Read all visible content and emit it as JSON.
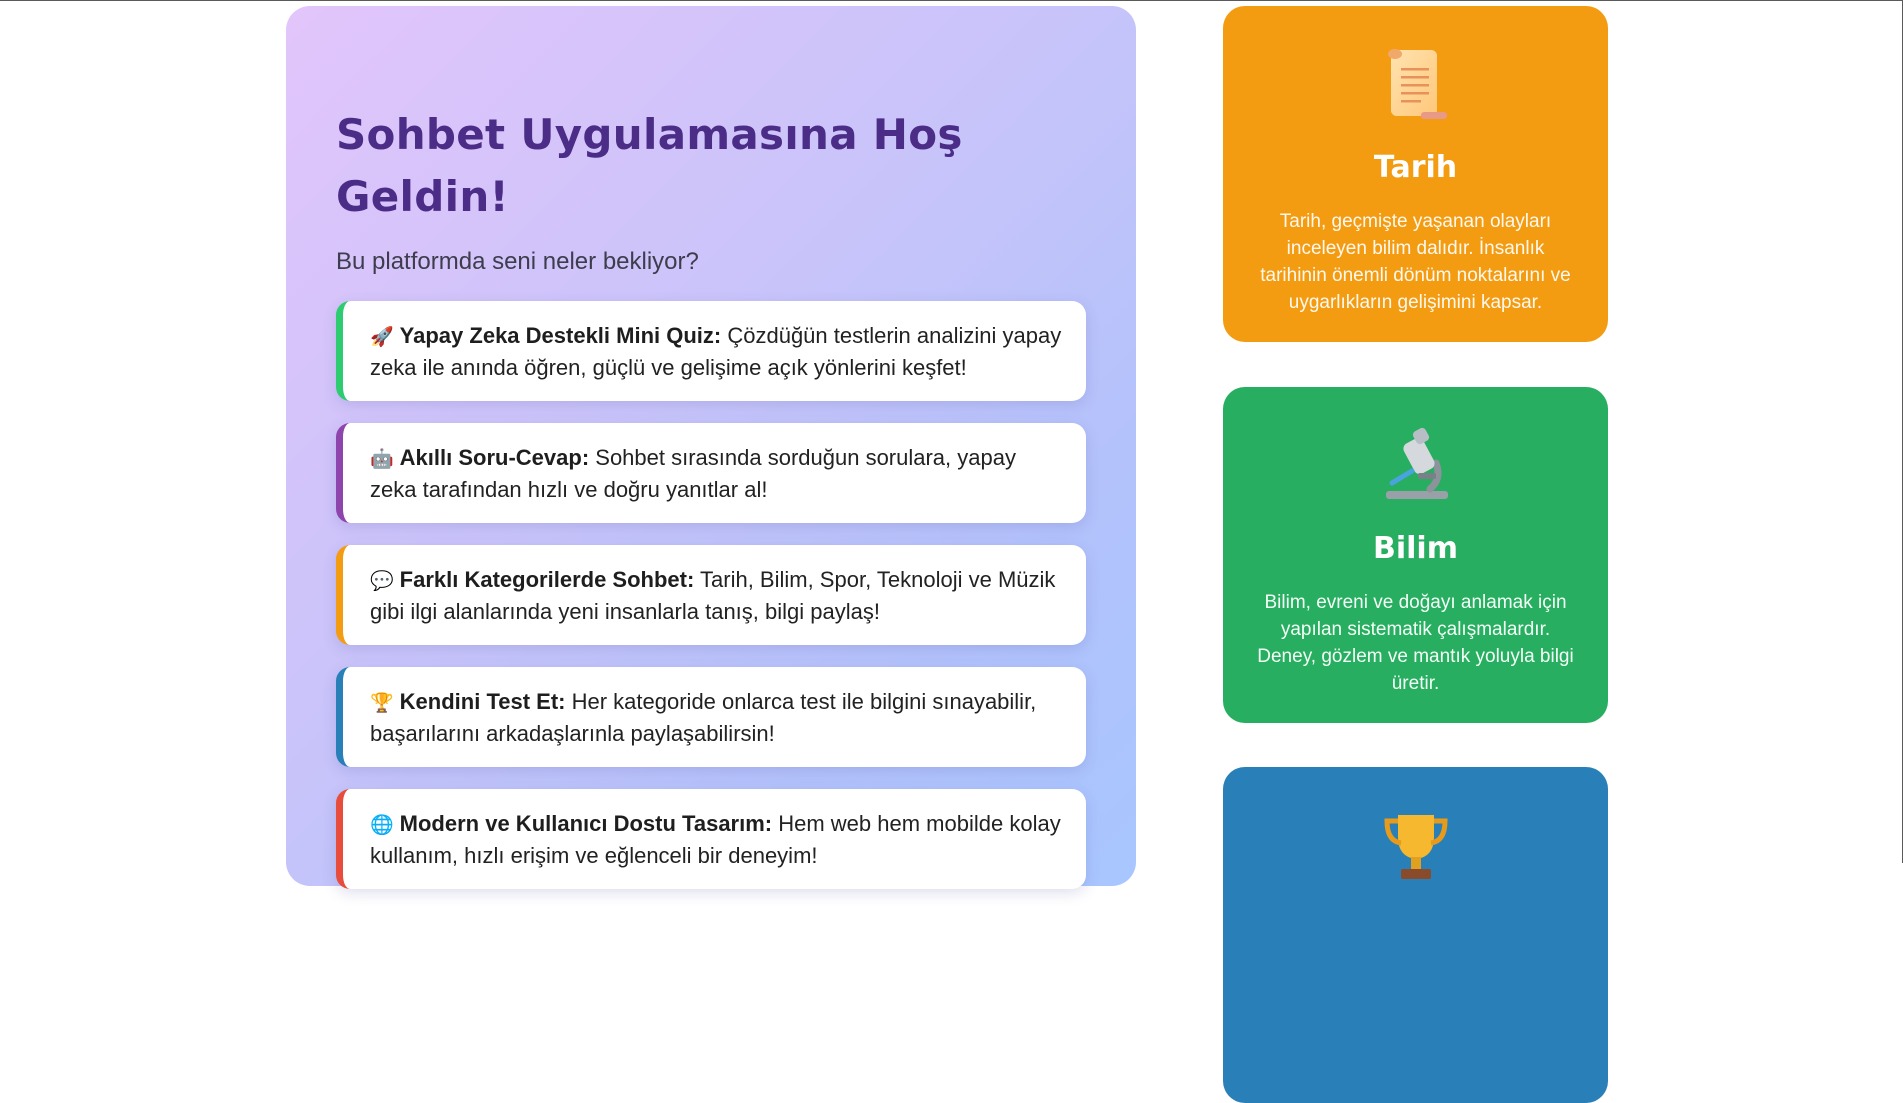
{
  "welcome": {
    "title": "Sohbet Uygulamasına Hoş Geldin!",
    "subtitle": "Bu platformda seni neler bekliyor?"
  },
  "features": [
    {
      "emoji": "🚀",
      "title": "Yapay Zeka Destekli Mini Quiz:",
      "text": " Çözdüğün testlerin analizini yapay zeka ile anında öğren, güçlü ve gelişime açık yönlerini keşfet!",
      "accent": "#2ecc71"
    },
    {
      "emoji": "🤖",
      "title": "Akıllı Soru-Cevap:",
      "text": " Sohbet sırasında sorduğun sorulara, yapay zeka tarafından hızlı ve doğru yanıtlar al!",
      "accent": "#8e44ad"
    },
    {
      "emoji": "💬",
      "title": "Farklı Kategorilerde Sohbet:",
      "text": " Tarih, Bilim, Spor, Teknoloji ve Müzik gibi ilgi alanlarında yeni insanlarla tanış, bilgi paylaş!",
      "accent": "#f39c12"
    },
    {
      "emoji": "🏆",
      "title": "Kendini Test Et:",
      "text": " Her kategoride onlarca test ile bilgini sınayabilir, başarılarını arkadaşlarınla paylaşabilirsin!",
      "accent": "#2980b9"
    },
    {
      "emoji": "🌐",
      "title": "Modern ve Kullanıcı Dostu Tasarım:",
      "text": " Hem web hem mobilde kolay kullanım, hızlı erişim ve eğlenceli bir deneyim!",
      "accent": "#e74c3c"
    }
  ],
  "categories": [
    {
      "name": "Tarih",
      "icon": "scroll-icon",
      "color": "#f39c12",
      "description": "Tarih, geçmişte yaşanan olayları inceleyen bilim dalıdır. İnsanlık tarihinin önemli dönüm noktalarını ve uygarlıkların gelişimini kapsar."
    },
    {
      "name": "Bilim",
      "icon": "microscope-icon",
      "color": "#27ae60",
      "description": "Bilim, evreni ve doğayı anlamak için yapılan sistematik çalışmalardır. Deney, gözlem ve mantık yoluyla bilgi üretir."
    },
    {
      "name": "",
      "icon": "trophy-icon",
      "color": "#2980b9",
      "description": ""
    }
  ]
}
